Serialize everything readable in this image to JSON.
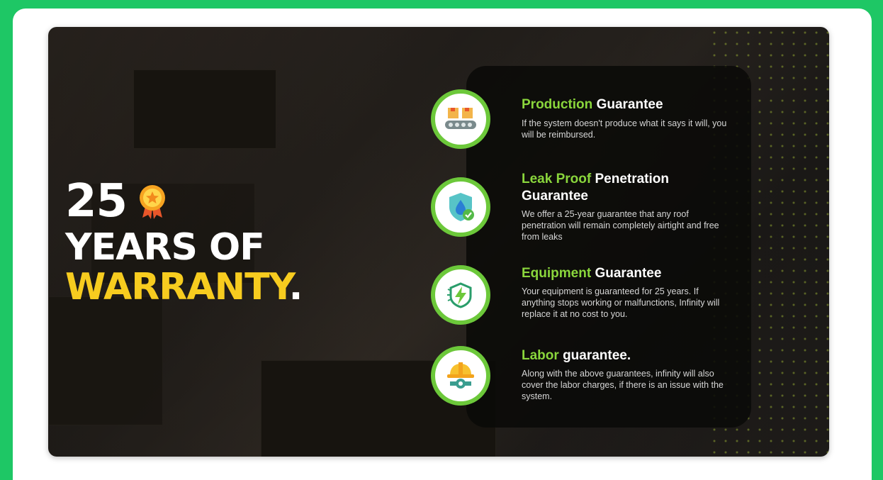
{
  "heading": {
    "number": "25",
    "line2": "YEARS OF",
    "line3": "WARRANTY",
    "line3_dot": "."
  },
  "colors": {
    "outer_bg": "#1ec765",
    "accent_green": "#8ad63c",
    "ring_green": "#6cc83a",
    "accent_yellow": "#f7cc1f"
  },
  "guarantees": [
    {
      "icon": "conveyor-boxes-icon",
      "title_highlight": "Production",
      "title_rest": "Guarantee",
      "description": "If the system doesn't produce what it says it will, you will be reimbursed."
    },
    {
      "icon": "shield-water-drop-icon",
      "title_highlight": "Leak Proof",
      "title_rest": "Penetration Guarantee",
      "description": "We offer a 25-year guarantee that any roof penetration will remain completely airtight and free from leaks"
    },
    {
      "icon": "shield-lightning-icon",
      "title_highlight": "Equipment",
      "title_rest": "Guarantee",
      "description": "Your equipment is guaranteed for 25 years. If anything stops working or malfunctions, Infinity will replace it at no cost to you."
    },
    {
      "icon": "hardhat-gear-icon",
      "title_highlight": "Labor",
      "title_rest": "guarantee.",
      "description": "Along with the above guarantees, infinity will also cover the labor charges, if there is an issue with the system."
    }
  ]
}
